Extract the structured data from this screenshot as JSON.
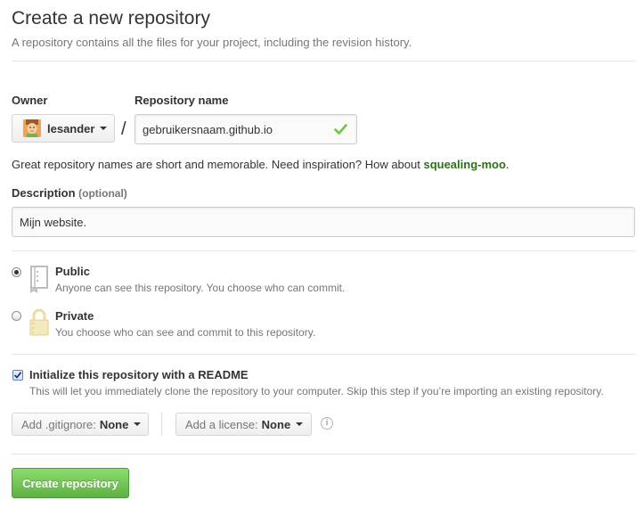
{
  "header": {
    "title": "Create a new repository",
    "subtitle": "A repository contains all the files for your project, including the revision history."
  },
  "owner": {
    "label": "Owner",
    "name": "lesander"
  },
  "repo": {
    "label": "Repository name",
    "value": "gebruikersnaam.github.io",
    "separator": "/"
  },
  "hint": {
    "text": "Great repository names are short and memorable. Need inspiration? How about ",
    "suggestion": "squealing-moo",
    "suffix": "."
  },
  "description": {
    "label": "Description",
    "optional": "(optional)",
    "value": "Mijn website."
  },
  "visibility": {
    "selected": "public",
    "options": [
      {
        "id": "public",
        "title": "Public",
        "desc": "Anyone can see this repository. You choose who can commit.",
        "icon": "book-icon"
      },
      {
        "id": "private",
        "title": "Private",
        "desc": "You choose who can see and commit to this repository.",
        "icon": "lock-icon"
      }
    ]
  },
  "init": {
    "checked": true,
    "title": "Initialize this repository with a README",
    "desc": "This will let you immediately clone the repository to your computer. Skip this step if you’re importing an existing repository."
  },
  "gitignore": {
    "label": "Add .gitignore:",
    "value": "None"
  },
  "license": {
    "label": "Add a license:",
    "value": "None"
  },
  "submit": {
    "label": "Create repository"
  },
  "colors": {
    "accent_green": "#60b044",
    "check_green": "#6cc644",
    "suggestion_green": "#2f6f1e"
  }
}
